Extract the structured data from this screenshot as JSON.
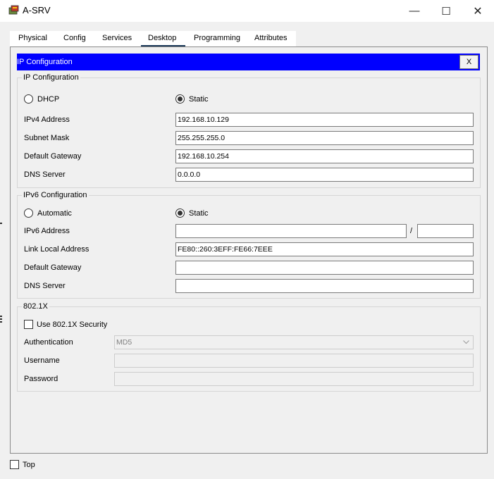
{
  "window": {
    "title": "A-SRV"
  },
  "window_controls": {
    "minimize": "—",
    "maximize": "☐",
    "close": "✕"
  },
  "tabs": [
    {
      "label": "Physical"
    },
    {
      "label": "Config"
    },
    {
      "label": "Services"
    },
    {
      "label": "Desktop",
      "active": true
    },
    {
      "label": "Programming"
    },
    {
      "label": "Attributes"
    }
  ],
  "ip_config_panel": {
    "title": "IP Configuration",
    "close_label": "X"
  },
  "ipv4": {
    "legend": "IP Configuration",
    "dhcp_label": "DHCP",
    "static_label": "Static",
    "mode": "Static",
    "address_label": "IPv4 Address",
    "address_value": "192.168.10.129",
    "mask_label": "Subnet Mask",
    "mask_value": "255.255.255.0",
    "gateway_label": "Default Gateway",
    "gateway_value": "192.168.10.254",
    "dns_label": "DNS Server",
    "dns_value": "0.0.0.0"
  },
  "ipv6": {
    "legend": "IPv6 Configuration",
    "automatic_label": "Automatic",
    "static_label": "Static",
    "mode": "Static",
    "address_label": "IPv6 Address",
    "address_value": "",
    "prefix_separator": "/",
    "prefix_value": "",
    "link_local_label": "Link Local Address",
    "link_local_value": "FE80::260:3EFF:FE66:7EEE",
    "gateway_label": "Default Gateway",
    "gateway_value": "",
    "dns_label": "DNS Server",
    "dns_value": ""
  },
  "dot1x": {
    "legend": "802.1X",
    "use_security_label": "Use 802.1X Security",
    "use_security_checked": false,
    "auth_label": "Authentication",
    "auth_value": "MD5",
    "username_label": "Username",
    "username_value": "",
    "password_label": "Password",
    "password_value": ""
  },
  "footer": {
    "top_label": "Top",
    "top_checked": false
  },
  "colors": {
    "header_bar": "#0000ff",
    "active_tab_underline": "#1d3a5a"
  }
}
